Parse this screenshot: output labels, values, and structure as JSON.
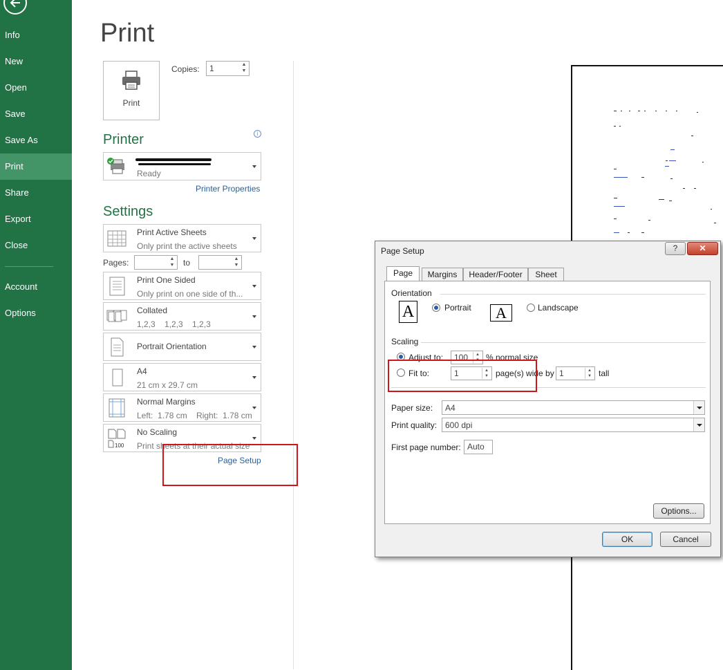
{
  "sidebar": {
    "items": [
      {
        "label": "Info"
      },
      {
        "label": "New"
      },
      {
        "label": "Open"
      },
      {
        "label": "Save"
      },
      {
        "label": "Save As"
      },
      {
        "label": "Print"
      },
      {
        "label": "Share"
      },
      {
        "label": "Export"
      },
      {
        "label": "Close"
      },
      {
        "label": "Account"
      },
      {
        "label": "Options"
      }
    ],
    "active": "Print"
  },
  "print": {
    "title": "Print",
    "button_label": "Print",
    "copies_label": "Copies:",
    "copies_value": "1"
  },
  "printer": {
    "heading": "Printer",
    "status": "Ready",
    "properties_link": "Printer Properties"
  },
  "settings": {
    "heading": "Settings",
    "what": {
      "title": "Print Active Sheets",
      "sub": "Only print the active sheets"
    },
    "pages_label": "Pages:",
    "to_label": "to",
    "sides": {
      "title": "Print One Sided",
      "sub": "Only print on one side of th..."
    },
    "collate": {
      "title": "Collated",
      "sub": "1,2,3    1,2,3    1,2,3"
    },
    "orientation": {
      "title": "Portrait Orientation"
    },
    "paper": {
      "title": "A4",
      "sub": "21 cm x 29.7 cm"
    },
    "margins": {
      "title": "Normal Margins",
      "sub": "Left:  1.78 cm    Right:  1.78 cm"
    },
    "scaling": {
      "title": "No Scaling",
      "sub": "Print sheets at their actual size"
    },
    "page_setup_link": "Page Setup"
  },
  "dialog": {
    "title": "Page Setup",
    "help": "?",
    "close": "✕",
    "tabs": [
      "Page",
      "Margins",
      "Header/Footer",
      "Sheet"
    ],
    "active_tab": "Page",
    "orientation_group": "Orientation",
    "portrait": "Portrait",
    "landscape": "Landscape",
    "orientation_selected": "Portrait",
    "scaling_group": "Scaling",
    "adjust_to": "Adjust to:",
    "adjust_value": "100",
    "normal_size": "% normal size",
    "fit_to": "Fit to:",
    "fit_wide_value": "1",
    "pages_wide_by": "page(s) wide by",
    "fit_tall_value": "1",
    "tall": "tall",
    "scaling_selected": "Adjust to",
    "paper_size_label": "Paper size:",
    "paper_size_value": "A4",
    "print_quality_label": "Print quality:",
    "print_quality_value": "600 dpi",
    "first_page_label": "First page number:",
    "first_page_value": "Auto",
    "options_btn": "Options...",
    "ok_btn": "OK",
    "cancel_btn": "Cancel"
  },
  "colors": {
    "sidebar_bg": "#217346",
    "sidebar_active": "#439467",
    "heading": "#217346",
    "link": "#2a6099",
    "highlight": "#d0141c"
  }
}
